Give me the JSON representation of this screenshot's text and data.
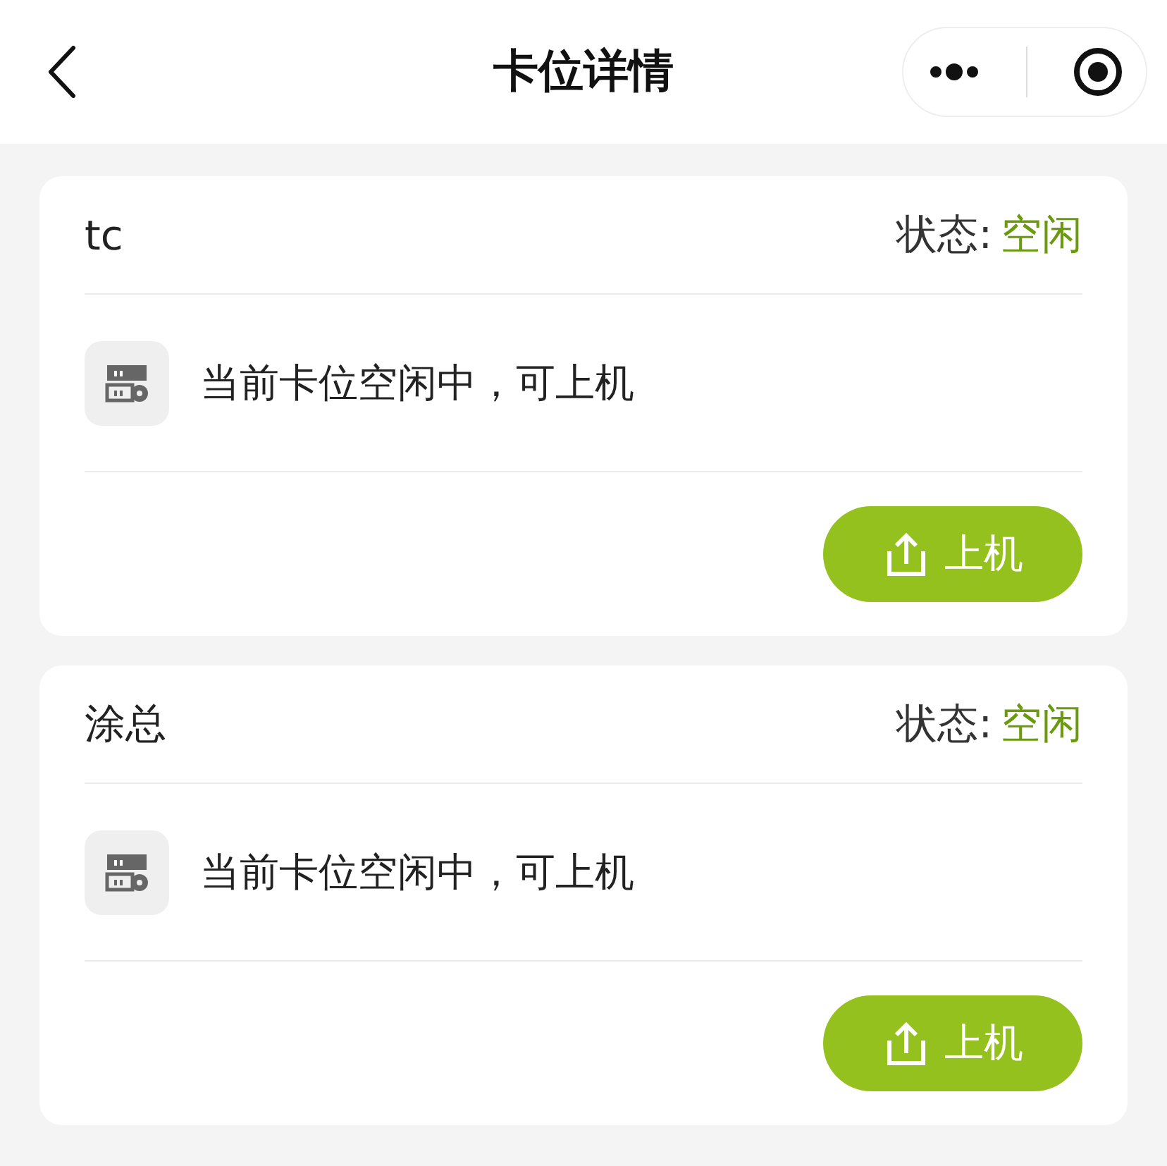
{
  "nav": {
    "title": "卡位详情"
  },
  "cards": [
    {
      "name": "tc",
      "status_label": "状态:",
      "status": "空闲",
      "color": "#6b9a10",
      "message": "当前卡位空闲中，可上机",
      "button": "上机"
    },
    {
      "name": "涂总",
      "status_label": "状态:",
      "status": "空闲",
      "color": "#6b9a10",
      "message": "当前卡位空闲中，可上机",
      "button": "上机"
    }
  ]
}
